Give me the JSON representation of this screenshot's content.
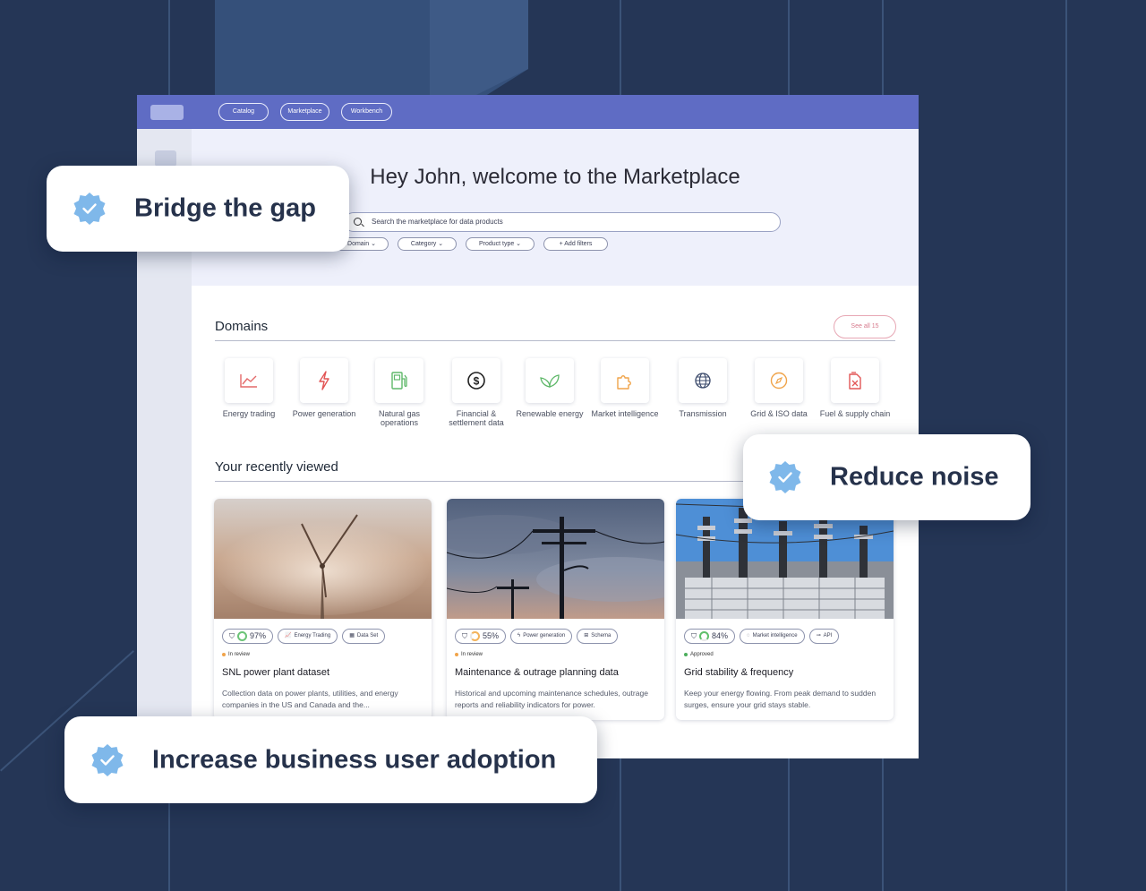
{
  "nav": {
    "catalog": "Catalog",
    "marketplace": "Marketplace",
    "workbench": "Workbench"
  },
  "hero": {
    "title": "Hey John, welcome to the Marketplace",
    "search_placeholder": "Search the marketplace for data products",
    "filters": {
      "domain": "Domain ⌄",
      "category": "Category ⌄",
      "product_type": "Product type ⌄",
      "add_filters": "+ Add filters"
    }
  },
  "domains": {
    "title": "Domains",
    "see_all": "See all 15",
    "items": [
      {
        "label": "Energy trading",
        "icon": "chart-line-icon",
        "color": "#e36a6a"
      },
      {
        "label": "Power generation",
        "icon": "bolt-icon",
        "color": "#e25555"
      },
      {
        "label": "Natural gas operations",
        "icon": "fuel-pump-icon",
        "color": "#5fb86a"
      },
      {
        "label": "Financial & settlement data",
        "icon": "dollar-icon",
        "color": "#222222"
      },
      {
        "label": "Renewable energy",
        "icon": "leaf-icon",
        "color": "#5fb86a"
      },
      {
        "label": "Market intelligence",
        "icon": "puzzle-icon",
        "color": "#f0a44a"
      },
      {
        "label": "Transmission",
        "icon": "globe-icon",
        "color": "#3b4a6b"
      },
      {
        "label": "Grid & ISO data",
        "icon": "compass-icon",
        "color": "#f0a44a"
      },
      {
        "label": "Fuel & supply chain",
        "icon": "fuel-can-icon",
        "color": "#e25555"
      }
    ]
  },
  "recent": {
    "title": "Your recently viewed",
    "cards": [
      {
        "score": "97%",
        "tag1": "Energy Trading",
        "tag2": "Data Set",
        "status": "In review",
        "status_color": "#f0a44a",
        "title": "SNL power plant dataset",
        "desc": "Collection data on power plants, utilities, and energy companies in the US and Canada and the..."
      },
      {
        "score": "55%",
        "tag1": "Power generation",
        "tag2": "Schema",
        "status": "In review",
        "status_color": "#f0a44a",
        "title": "Maintenance & outrage planning data",
        "desc": "Historical and upcoming maintenance schedules, outrage reports and reliability indicators for power."
      },
      {
        "score": "84%",
        "tag1": "Market intelligence",
        "tag2": "API",
        "status": "Approved",
        "status_color": "#4cae5c",
        "title": "Grid stability & frequency",
        "desc": "Keep your energy flowing. From peak demand to sudden surges, ensure your grid stays stable."
      }
    ]
  },
  "callouts": {
    "bridge": "Bridge the gap",
    "reduce": "Reduce noise",
    "adoption": "Increase business user adoption"
  },
  "colors": {
    "topbar": "#5f6cc4",
    "background": "#253656",
    "check": "#7fb8ea"
  }
}
